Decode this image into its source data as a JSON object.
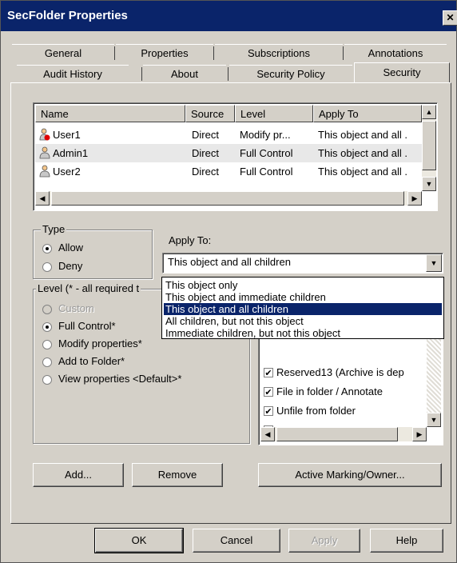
{
  "window": {
    "title": "SecFolder Properties",
    "close": "✕"
  },
  "tabs_row1": [
    "General",
    "Properties",
    "Subscriptions",
    "Annotations"
  ],
  "tabs_row2": [
    "Audit History",
    "About",
    "Security Policy",
    "Security"
  ],
  "active_tab": "Security",
  "permissions": {
    "columns": [
      "Name",
      "Source",
      "Level",
      "Apply To"
    ],
    "rows": [
      {
        "name": "User1",
        "source": "Direct",
        "level": "Modify pr...",
        "apply_to": "This object and all ."
      },
      {
        "name": "Admin1",
        "source": "Direct",
        "level": "Full Control",
        "apply_to": "This object and all ."
      },
      {
        "name": "User2",
        "source": "Direct",
        "level": "Full Control",
        "apply_to": "This object and all ."
      }
    ]
  },
  "type_group": {
    "label": "Type",
    "options": [
      "Allow",
      "Deny"
    ],
    "selected": "Allow"
  },
  "apply_to": {
    "label": "Apply To:",
    "value": "This object and all children",
    "options": [
      "This object only",
      "This object and immediate children",
      "This object and all children",
      "All children, but not this object",
      "Immediate children, but not this object"
    ],
    "selected_index": 2
  },
  "level_group": {
    "label": "Level (* - all required t",
    "options": [
      "Custom",
      "Full Control*",
      "Modify properties*",
      "Add to Folder*",
      "View properties <Default>*"
    ],
    "selected": "Full Control*",
    "disabled": [
      "Custom"
    ]
  },
  "rights": [
    {
      "label": "Reserved13 (Archive is dep",
      "checked": true
    },
    {
      "label": "File in folder / Annotate",
      "checked": true
    },
    {
      "label": "Unfile from folder",
      "checked": true
    }
  ],
  "buttons": {
    "add": "Add...",
    "remove": "Remove",
    "active_marking": "Active Marking/Owner...",
    "ok": "OK",
    "cancel": "Cancel",
    "apply": "Apply",
    "help": "Help"
  },
  "colors": {
    "title_bar": "#0a246a",
    "selection": "#0a246a",
    "face": "#d4d0c8"
  }
}
